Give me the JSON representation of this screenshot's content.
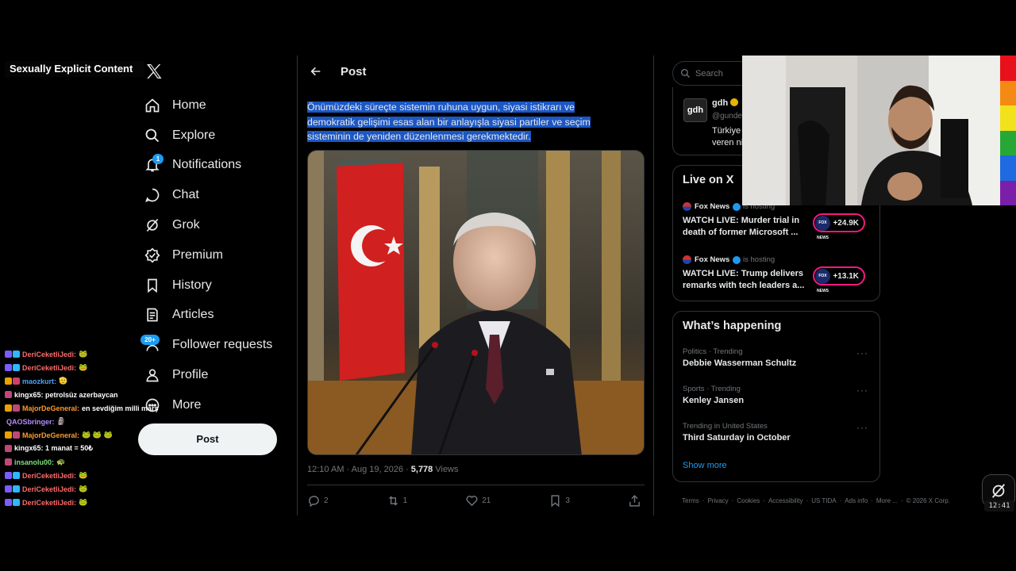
{
  "overlay": {
    "warning_label": "Sexually Explicit Content",
    "clock": "12:41"
  },
  "nav": {
    "items": [
      {
        "label": "Home",
        "icon": "home-icon"
      },
      {
        "label": "Explore",
        "icon": "search-icon"
      },
      {
        "label": "Notifications",
        "icon": "bell-icon",
        "badge": "1"
      },
      {
        "label": "Chat",
        "icon": "chat-icon"
      },
      {
        "label": "Grok",
        "icon": "grok-icon"
      },
      {
        "label": "Premium",
        "icon": "premium-icon"
      },
      {
        "label": "History",
        "icon": "bookmark-icon"
      },
      {
        "label": "Articles",
        "icon": "article-icon"
      },
      {
        "label": "Follower requests",
        "icon": "follower-requests-icon",
        "badge": "20+"
      },
      {
        "label": "Profile",
        "icon": "person-icon"
      },
      {
        "label": "More",
        "icon": "more-circle-icon"
      }
    ],
    "post_button": "Post"
  },
  "chat": [
    {
      "user": "DeriCeketliJedi:",
      "color": "#ff6b6b",
      "badges": [
        "#7b5cff",
        "#2fb7ff"
      ],
      "msg": "🐸"
    },
    {
      "user": "DeriCeketliJedi:",
      "color": "#ff6b6b",
      "badges": [
        "#7b5cff",
        "#2fb7ff"
      ],
      "msg": "🐸"
    },
    {
      "user": "maozkurt:",
      "color": "#4aa3ff",
      "badges": [
        "#e8a200",
        "#d0406a"
      ],
      "msg": "🫡"
    },
    {
      "user": "kingx65: petrolsüz azerbaycan",
      "color": "#ffffff",
      "badges": [
        "#c04878"
      ],
      "msg": ""
    },
    {
      "user": "MajorDeGeneral:",
      "color": "#ff9a2e",
      "badges": [
        "#e8a200",
        "#c04878"
      ],
      "msg": "en sevdiğim milli marş"
    },
    {
      "user": "QAOSbringer:",
      "color": "#b58cff",
      "badges": [],
      "msg": "🗿"
    },
    {
      "user": "MajorDeGeneral:",
      "color": "#ff9a2e",
      "badges": [
        "#e8a200",
        "#c04878"
      ],
      "msg": "🐸 🐸 🐸"
    },
    {
      "user": "kingx65: 1 manat = 50₺",
      "color": "#ffffff",
      "badges": [
        "#c04878"
      ],
      "msg": ""
    },
    {
      "user": "insanolu00:",
      "color": "#7ee07e",
      "badges": [
        "#c04878"
      ],
      "msg": "🐢"
    },
    {
      "user": "DeriCeketliJedi:",
      "color": "#ff6b6b",
      "badges": [
        "#7b5cff",
        "#2fb7ff"
      ],
      "msg": "🐸"
    },
    {
      "user": "DeriCeketliJedi:",
      "color": "#ff6b6b",
      "badges": [
        "#7b5cff",
        "#2fb7ff"
      ],
      "msg": "🐸"
    },
    {
      "user": "DeriCeketliJedi:",
      "color": "#ff6b6b",
      "badges": [
        "#7b5cff",
        "#2fb7ff"
      ],
      "msg": "🐸"
    }
  ],
  "post": {
    "header": "Post",
    "text": "Önümüzdeki süreçte sistemin ruhuna uygun, siyasi istikrarı ve demokratik gelişimi esas alan bir anlayışla siyasi partiler ve seçim sisteminin de yeniden düzenlenmesi gerekmektedir.",
    "time": "12:10 AM · Aug 19, 2026",
    "views_count": "5,778",
    "views_label": "Views",
    "replies": "2",
    "reposts": "1",
    "likes": "21",
    "bookmarks": "3"
  },
  "sidebar": {
    "search_placeholder": "Search",
    "gdh": {
      "logo": "gdh",
      "name": "gdh",
      "handle": "@gunde",
      "text_line1": "Türkiye",
      "text_line2": "veren ni"
    },
    "live": {
      "title": "Live on X",
      "items": [
        {
          "host": "Fox News",
          "status": "is hosting",
          "title": "WATCH LIVE: Murder trial in death of former Microsoft ...",
          "count": "+24.9K"
        },
        {
          "host": "Fox News",
          "status": "is hosting",
          "title": "WATCH LIVE: Trump delivers remarks with tech leaders a...",
          "count": "+13.1K"
        }
      ],
      "fox_logo": "FOX NEWS"
    },
    "happening": {
      "title": "What’s happening",
      "trends": [
        {
          "category": "Politics · Trending",
          "name": "Debbie Wasserman Schultz"
        },
        {
          "category": "Sports · Trending",
          "name": "Kenley Jansen"
        },
        {
          "category": "Trending in United States",
          "name": "Third Saturday in October"
        }
      ],
      "show_more": "Show more"
    },
    "footer": [
      "Terms",
      "Privacy",
      "Cookies",
      "Accessibility",
      "US TIDA",
      "Ads info",
      "More ...",
      "© 2026 X Corp."
    ]
  },
  "colors": {
    "accent": "#1d9bf0",
    "live_pill": "#f91880",
    "selection": "#1c57c4",
    "color_bars": [
      "#e8101a",
      "#f58a12",
      "#f2e21b",
      "#27a836",
      "#1f6ae0",
      "#7a1fa8"
    ]
  }
}
